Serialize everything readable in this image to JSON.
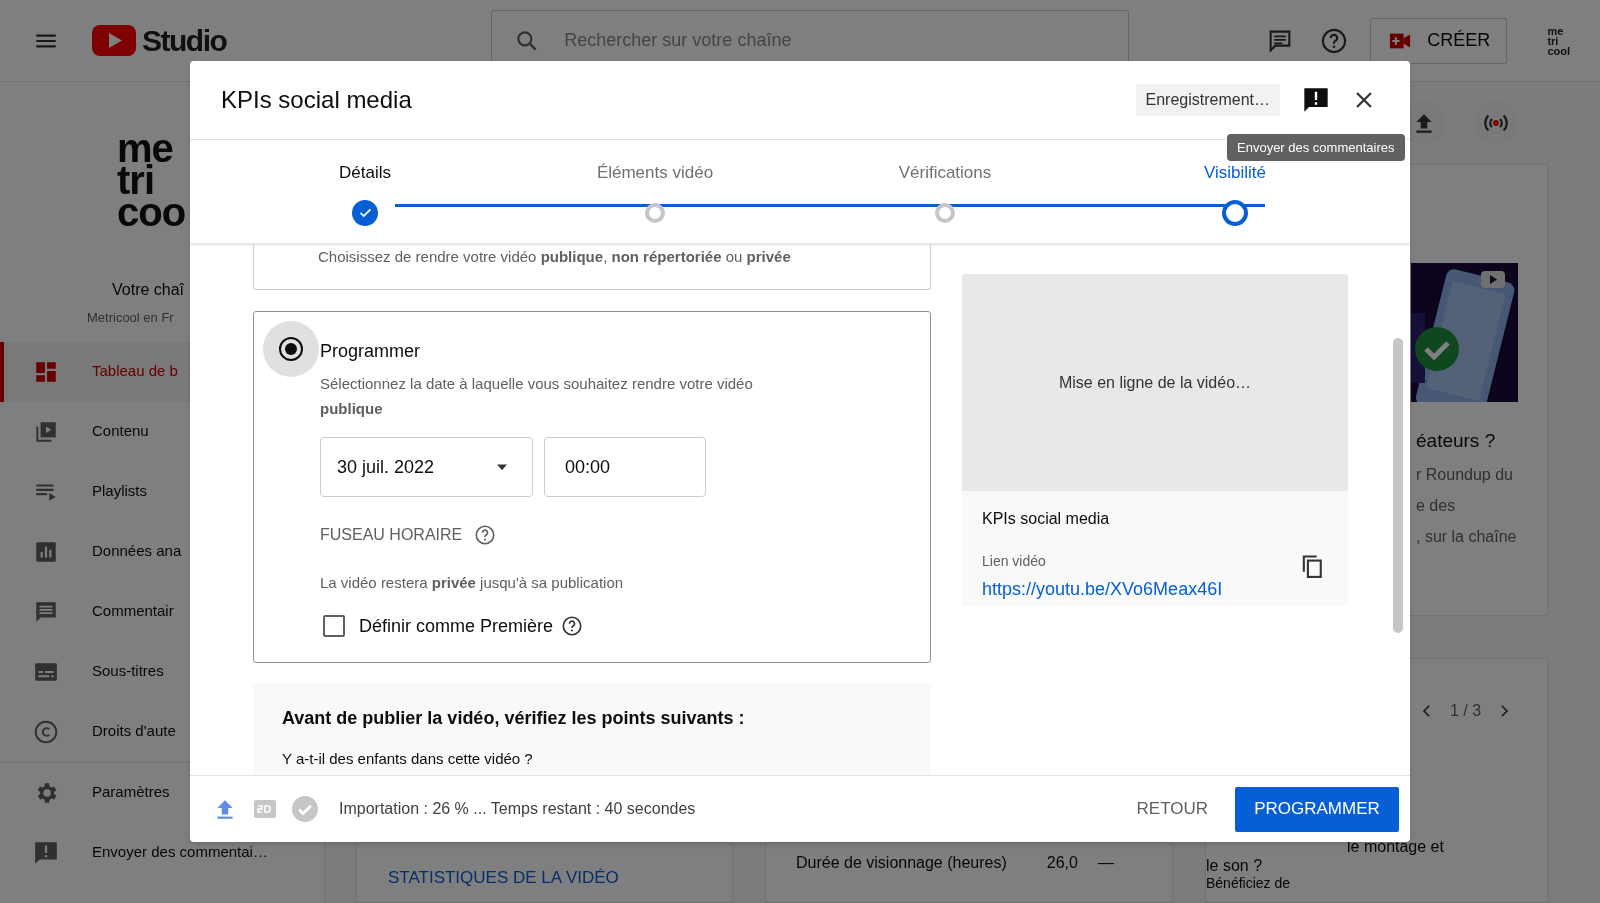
{
  "header": {
    "logo_text": "Studio",
    "search_placeholder": "Rechercher sur votre chaîne",
    "create_button": "CRÉER",
    "avatar_lines": [
      "me",
      "tri",
      "cool"
    ]
  },
  "sidebar": {
    "channel_logo_lines": [
      "me",
      "tri",
      "coo"
    ],
    "channel_title": "Votre chaî",
    "channel_name": "Metricool en Fr",
    "items": [
      {
        "label": "Tableau de b",
        "selected": true
      },
      {
        "label": "Contenu",
        "selected": false
      },
      {
        "label": "Playlists",
        "selected": false
      },
      {
        "label": "Données ana",
        "selected": false
      },
      {
        "label": "Commentair",
        "selected": false
      },
      {
        "label": "Sous-titres",
        "selected": false
      },
      {
        "label": "Droits d'aute",
        "selected": false
      }
    ],
    "bottom_items": [
      {
        "label": "Paramètres",
        "selected": false
      },
      {
        "label": "Envoyer des commentai…",
        "selected": false
      }
    ]
  },
  "dashboard": {
    "video_stats_link": "STATISTIQUES DE LA VIDÉO",
    "metric_label": "Durée de visionnage (heures)",
    "metric_value": "26,0",
    "metric_change": "—",
    "news_card": {
      "title": "éateurs ?",
      "lines": [
        "r Roundup du",
        "e des",
        ", sur la chaîne"
      ]
    },
    "pager": "1 / 3",
    "help_card": {
      "title_lines": [
        "le montage et",
        "le son ?"
      ],
      "text": "Bénéficiez de"
    }
  },
  "dialog": {
    "title": "KPIs social media",
    "save_status": "Enregistrement…",
    "tooltip": "Envoyer des commentaires",
    "steps": [
      {
        "label": "Détails",
        "done": true,
        "selected": false
      },
      {
        "label": "Éléments vidéo",
        "done": false,
        "selected": false
      },
      {
        "label": "Vérifications",
        "done": false,
        "selected": false
      },
      {
        "label": "Visibilité",
        "done": false,
        "selected": true
      }
    ],
    "visibility_intro": "Choisissez de rendre votre vidéo **publique**, **non répertoriée** ou **privée**",
    "schedule": {
      "label": "Programmer",
      "selected": true,
      "description": "Sélectionnez la date à laquelle vous souhaitez rendre votre vidéo **publique**",
      "date": "30 juil. 2022",
      "time": "00:00",
      "timezone_label": "FUSEAU HORAIRE",
      "note": "La vidéo restera **privée** jusqu'à sa publication",
      "premiere": {
        "label": "Définir comme Première",
        "checked": false
      }
    },
    "checklist": {
      "title": "Avant de publier la vidéo, vérifiez les points suivants :",
      "question": "Y a-t-il des enfants dans cette vidéo ?"
    },
    "preview": {
      "status": "Mise en ligne de la vidéo…",
      "video_title": "KPIs social media",
      "link_label": "Lien vidéo",
      "link": "https://youtu.be/XVo6Meax46I"
    },
    "footer": {
      "status_icons": [
        {
          "kind": "upload",
          "done": true
        },
        {
          "kind": "sd",
          "done": false
        },
        {
          "kind": "check",
          "done": false
        }
      ],
      "progress": "Importation : 26 % ... Temps restant : 40 secondes",
      "back_button": "RETOUR",
      "submit_button": "PROGRAMMER"
    }
  }
}
